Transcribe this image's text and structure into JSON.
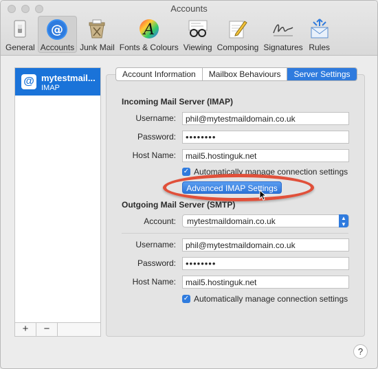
{
  "window": {
    "title": "Accounts"
  },
  "toolbar": {
    "items": [
      {
        "label": "General",
        "icon": "general-switch-icon"
      },
      {
        "label": "Accounts",
        "icon": "at-sign-icon",
        "active": true
      },
      {
        "label": "Junk Mail",
        "icon": "junk-bin-icon"
      },
      {
        "label": "Fonts & Colours",
        "icon": "fonts-colors-icon"
      },
      {
        "label": "Viewing",
        "icon": "glasses-icon"
      },
      {
        "label": "Composing",
        "icon": "pencil-paper-icon"
      },
      {
        "label": "Signatures",
        "icon": "signature-icon"
      },
      {
        "label": "Rules",
        "icon": "rules-envelope-icon"
      }
    ]
  },
  "sidebar": {
    "account_name": "mytestmail...",
    "account_type": "IMAP",
    "add_label": "+",
    "remove_label": "−"
  },
  "tabs": [
    {
      "label": "Account Information",
      "active": false
    },
    {
      "label": "Mailbox Behaviours",
      "active": false
    },
    {
      "label": "Server Settings",
      "active": true
    }
  ],
  "incoming": {
    "title": "Incoming Mail Server (IMAP)",
    "username_label": "Username:",
    "username": "phil@mytestmaildomain.co.uk",
    "password_label": "Password:",
    "password": "••••••••",
    "host_label": "Host Name:",
    "host": "mail5.hostinguk.net",
    "auto_manage_label": "Automatically manage connection settings",
    "auto_manage_checked": true,
    "advanced_button": "Advanced IMAP Settings"
  },
  "outgoing": {
    "title": "Outgoing Mail Server (SMTP)",
    "account_label": "Account:",
    "account": "mytestmaildomain.co.uk",
    "username_label": "Username:",
    "username": "phil@mytestmaildomain.co.uk",
    "password_label": "Password:",
    "password": "••••••••",
    "host_label": "Host Name:",
    "host": "mail5.hostinguk.net",
    "auto_manage_label": "Automatically manage connection settings",
    "auto_manage_checked": true
  },
  "help": {
    "label": "?"
  },
  "colors": {
    "accent": "#2f7bde",
    "highlight_ring": "#e0503a",
    "selection": "#1a73d9"
  }
}
